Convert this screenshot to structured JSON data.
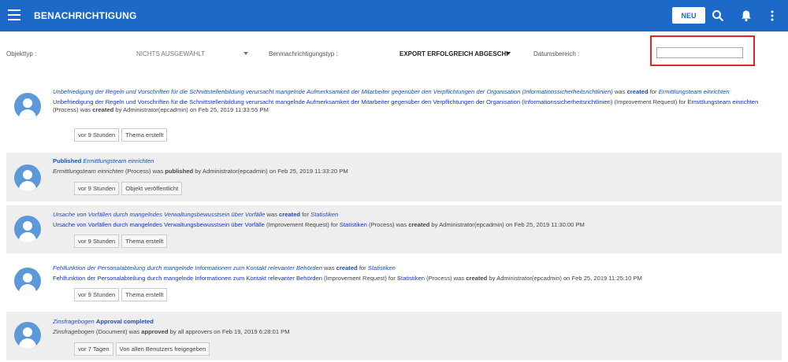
{
  "header": {
    "title": "BENACHRICHTIGUNG",
    "new_label": "NEU",
    "icons": [
      "menu-icon",
      "search-icon",
      "bell-icon",
      "more-vert-icon"
    ],
    "color": "#1c69c7"
  },
  "filters": {
    "object_type_label": "Objekttyp :",
    "object_type_value": "NICHTS AUSGEWÄHLT",
    "notification_type_label": "Benmachrichtigungstyp :",
    "notification_type_value": "EXPORT ERFOLGREICH ABGESCHl",
    "date_range_label": "Datumsbereich :",
    "date_range_value": ""
  },
  "feed": [
    {
      "h_italic": "Unbefriedigung der Regeln und Vorschriften für die Schnittstellenbildung verursacht mangelnde Aufmerksamkeit der Mitarbeiter gegenüber den Verpflichtungen der Organisation (Informationssicherheitsrichtlinien)",
      "h_was": " was ",
      "h_action": "created",
      "h_for": " for ",
      "h_target": "Ermittlungsteam einrichten",
      "d_link": "Unbefriedigung der Regeln und Vorschriften für die Schnittstellenbildung verursacht mangelnde Aufmerksamkeit der Mitarbeiter gegenüber den Verpflichtungen der Organisation (Informationssicherheitsrichtlinien)",
      "d_type": " (Improvement Request) for ",
      "d_link2": "Ermittlungsteam einrichten",
      "d_type2": " (Process) was ",
      "d_action": "created",
      "d_rest": " by Administrator(epcadmin) on Feb 25, 2019 11:33:55 PM",
      "time": "vor 9 Stunden",
      "tag": "Thema erstellt"
    },
    {
      "h_bold": "Published",
      "h_italic": "Ermittlungsteam einrichten",
      "d_italic": "Ermittlungsteam einrichten",
      "d_type": " (Process) was ",
      "d_action": "published",
      "d_rest": " by Administrator(epcadmin) on Feb 25, 2019 11:33:20 PM",
      "time": "vor 9 Stunden",
      "tag": "Objekt veröffentlicht"
    },
    {
      "h_italic": "Ursache von Vorfällen durch mangelndes Verwaltungsbewusstsein über Vorfälle",
      "h_was": " was ",
      "h_action": "created",
      "h_for": " for ",
      "h_target": "Statistiken",
      "d_link": "Ursache von Vorfällen durch mangelndes Verwaltungsbewusstsein über Vorfälle",
      "d_type": " (Improvement Request) for ",
      "d_link2": "Statistiken",
      "d_type2": " (Process) was ",
      "d_action": "created",
      "d_rest": " by Administrator(epcadmin) on Feb 25, 2019 11:30:00 PM",
      "time": "vor 9 Stunden",
      "tag": "Thema erstellt"
    },
    {
      "h_italic": "Fehlfunktion der Personalabteilung durch mangelnde Informationen zum Kontakt relevanter Behörden",
      "h_was": " was ",
      "h_action": "created",
      "h_for": " for ",
      "h_target": "Statistiken",
      "d_link": "Fehlfunktion der Personalabteilung durch mangelnde Informationen zum Kontakt relevanter Behörden",
      "d_type": " (Improvement Request) for ",
      "d_link2": "Statistiken",
      "d_type2": " (Process) was ",
      "d_action": "created",
      "d_rest": " by Administrator(epcadmin) on Feb 25, 2019 11:25:10 PM",
      "time": "vor 9 Stunden",
      "tag": "Thema erstellt"
    },
    {
      "h_italic": "Zinsfragebogen",
      "h_bold": "Approval completed",
      "d_italic": "Zinsfragebogen",
      "d_type": " (Document) was ",
      "d_action": "approved",
      "d_rest": " by all approvers on Feb 19, 2019 6:28:01 PM",
      "time": "vor 7 Tagen",
      "tag": "Von allen Benutzers freigegeben"
    }
  ]
}
